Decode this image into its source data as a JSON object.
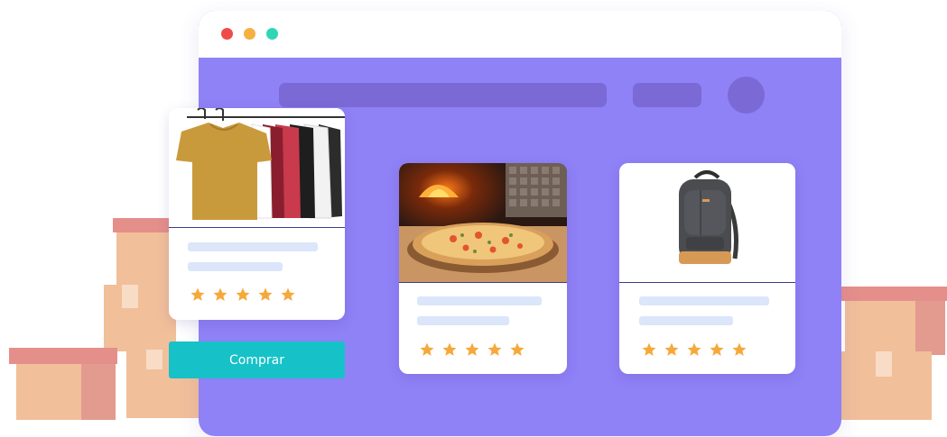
{
  "buy_button": {
    "label": "Comprar"
  },
  "cards": [
    {
      "image": "clothes-rack-image",
      "rating": 5
    },
    {
      "image": "pizza-image",
      "rating": 5
    },
    {
      "image": "backpack-image",
      "rating": 5
    }
  ],
  "colors": {
    "window_background": "#8f81f6",
    "placeholder_bar": "#7b6ad6",
    "star": "#f6a93b",
    "buy_button": "#16c2c7",
    "box_front": "#f1bf9a",
    "box_flap": "#e58f8a"
  }
}
